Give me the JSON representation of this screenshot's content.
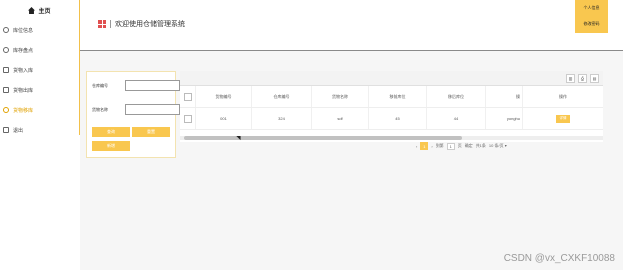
{
  "sidebar": {
    "home": "主页",
    "items": [
      {
        "label": "库位信息",
        "icon": "gear-icon",
        "active": false
      },
      {
        "label": "库存盘点",
        "icon": "settings-icon",
        "active": false
      },
      {
        "label": "货物入库",
        "icon": "inbox-icon",
        "active": false
      },
      {
        "label": "货物出库",
        "icon": "outbox-icon",
        "active": false
      },
      {
        "label": "货物移库",
        "icon": "transfer-icon",
        "active": true
      },
      {
        "label": "退出",
        "icon": "logout-icon",
        "active": false
      }
    ]
  },
  "header": {
    "title": "欢迎使用仓储管理系统",
    "user_menu": [
      "个人信息",
      "修改密码"
    ]
  },
  "search": {
    "warehouse_label": "仓库编号",
    "warehouse_value": "",
    "goods_label": "货物名称",
    "goods_value": "",
    "query_btn": "查询",
    "reset_btn": "重置",
    "add_btn": "新增"
  },
  "table": {
    "columns": [
      "货物编号",
      "仓库编号",
      "货物名称",
      "移前库位",
      "移后库位",
      "操",
      "操作"
    ],
    "rows": [
      {
        "goods_id": "001",
        "warehouse_id": "324",
        "goods_name": "sdf",
        "before": "45",
        "after": "44",
        "operator": "yonghu",
        "action": "详情"
      }
    ]
  },
  "pagination": {
    "prev": "‹",
    "current": "1",
    "next": "›",
    "goto_label": "到第",
    "page_input": "1",
    "page_unit": "页",
    "confirm": "确定",
    "total": "共1条",
    "page_size": "10 条/页"
  },
  "watermark": "CSDN @vx_CXKF10088"
}
